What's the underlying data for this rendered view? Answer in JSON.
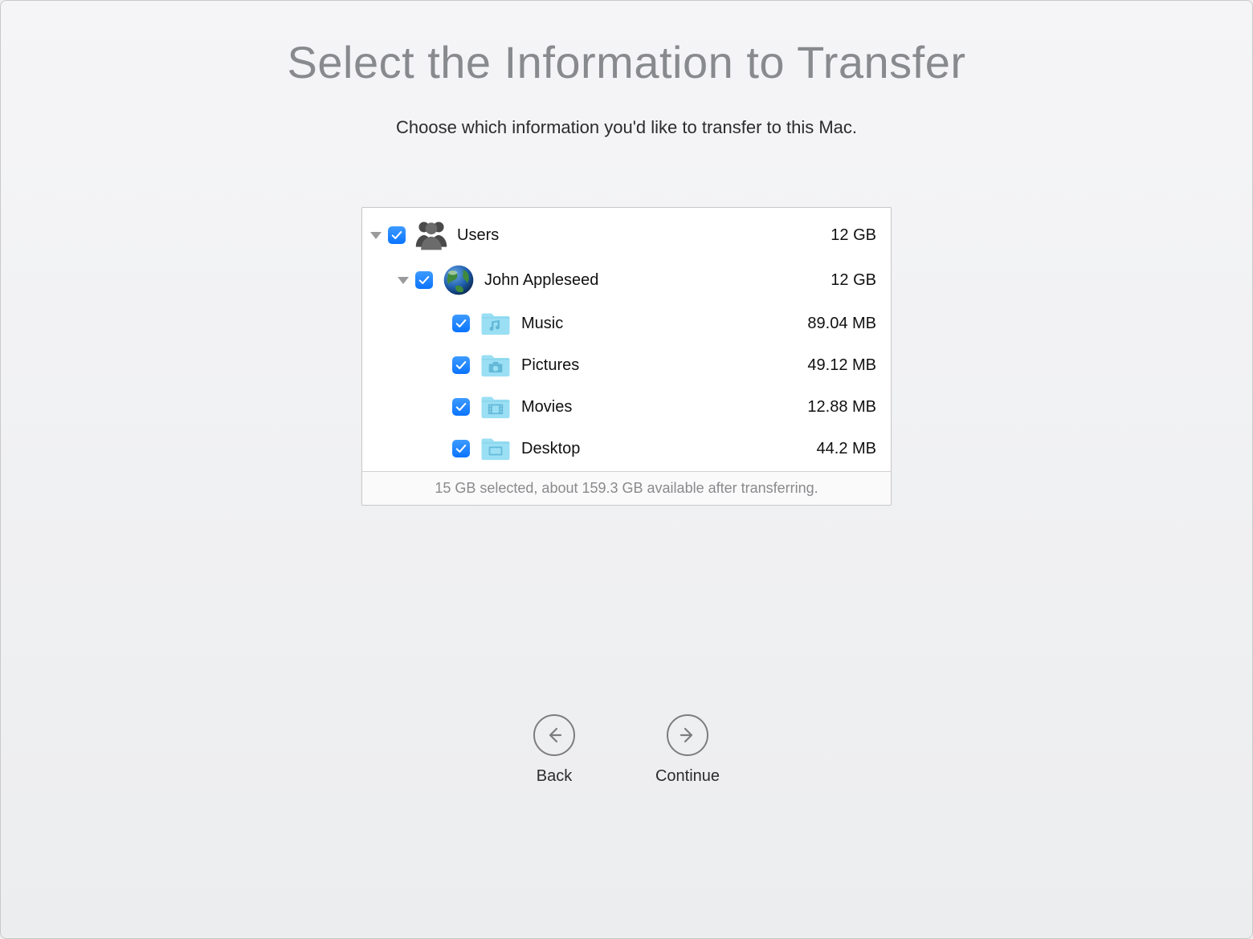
{
  "header": {
    "title": "Select the Information to Transfer",
    "subtitle": "Choose which information you'd like to transfer to this Mac."
  },
  "tree": {
    "users": {
      "label": "Users",
      "size": "12 GB",
      "children": {
        "user": {
          "name": "John Appleseed",
          "size": "12 GB",
          "items": [
            {
              "label": "Music",
              "size": "89.04 MB",
              "icon": "music-folder"
            },
            {
              "label": "Pictures",
              "size": "49.12 MB",
              "icon": "pictures-folder"
            },
            {
              "label": "Movies",
              "size": "12.88 MB",
              "icon": "movies-folder"
            },
            {
              "label": "Desktop",
              "size": "44.2 MB",
              "icon": "desktop-folder"
            }
          ]
        }
      }
    }
  },
  "status": "15 GB selected, about 159.3 GB available after transferring.",
  "nav": {
    "back": "Back",
    "continue": "Continue"
  }
}
